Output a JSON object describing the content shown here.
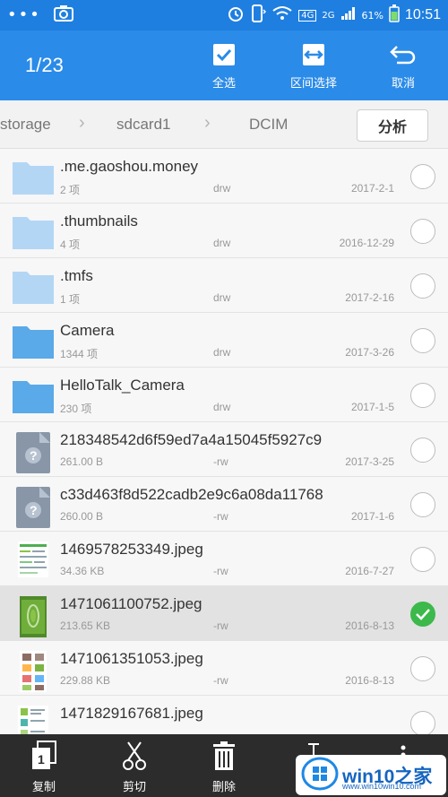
{
  "status_bar": {
    "network_badge": "4G",
    "network_badge2": "2G",
    "battery": "61%",
    "time": "10:51"
  },
  "app_bar": {
    "counter": "1/23",
    "actions": [
      {
        "label": "全选",
        "icon": "checkbox-icon"
      },
      {
        "label": "区间选择",
        "icon": "range-select-icon"
      },
      {
        "label": "取消",
        "icon": "back-arrow-icon"
      }
    ]
  },
  "breadcrumb": {
    "items": [
      "storage",
      "sdcard1",
      "DCIM"
    ],
    "analyze_label": "分析"
  },
  "files": [
    {
      "name": ".me.gaoshou.money",
      "meta": "2 项",
      "perm": "drw",
      "date": "2017-2-1",
      "type": "folder-light",
      "selected": false
    },
    {
      "name": ".thumbnails",
      "meta": "4 项",
      "perm": "drw",
      "date": "2016-12-29",
      "type": "folder-light",
      "selected": false
    },
    {
      "name": ".tmfs",
      "meta": "1 项",
      "perm": "drw",
      "date": "2017-2-16",
      "type": "folder-light",
      "selected": false
    },
    {
      "name": "Camera",
      "meta": "1344 项",
      "perm": "drw",
      "date": "2017-3-26",
      "type": "folder",
      "selected": false
    },
    {
      "name": "HelloTalk_Camera",
      "meta": "230 项",
      "perm": "drw",
      "date": "2017-1-5",
      "type": "folder",
      "selected": false
    },
    {
      "name": "218348542d6f59ed7a4a15045f5927c9",
      "meta": "261.00 B",
      "perm": "-rw",
      "date": "2017-3-25",
      "type": "unknown",
      "selected": false
    },
    {
      "name": "c33d463f8d522cadb2e9c6a08da11768",
      "meta": "260.00 B",
      "perm": "-rw",
      "date": "2017-1-6",
      "type": "unknown",
      "selected": false
    },
    {
      "name": "1469578253349.jpeg",
      "meta": "34.36 KB",
      "perm": "-rw",
      "date": "2016-7-27",
      "type": "image-doc",
      "selected": false
    },
    {
      "name": "1471061100752.jpeg",
      "meta": "213.65 KB",
      "perm": "-rw",
      "date": "2016-8-13",
      "type": "image-green",
      "selected": true
    },
    {
      "name": "1471061351053.jpeg",
      "meta": "229.88 KB",
      "perm": "-rw",
      "date": "2016-8-13",
      "type": "image-grid",
      "selected": false
    },
    {
      "name": "1471829167681.jpeg",
      "meta": "",
      "perm": "",
      "date": "",
      "type": "image-doc2",
      "selected": false
    }
  ],
  "bottom_bar": {
    "items": [
      {
        "label": "复制",
        "icon": "copy-icon"
      },
      {
        "label": "剪切",
        "icon": "scissors-icon"
      },
      {
        "label": "删除",
        "icon": "trash-icon"
      }
    ]
  },
  "watermark": {
    "text": "win10之家",
    "sub": "www.win10win10.com"
  },
  "colors": {
    "accent": "#2b8be8",
    "status_bar": "#1f7fe0",
    "selected_check": "#3cb94a",
    "bottom_bar": "#2c2c2c"
  }
}
